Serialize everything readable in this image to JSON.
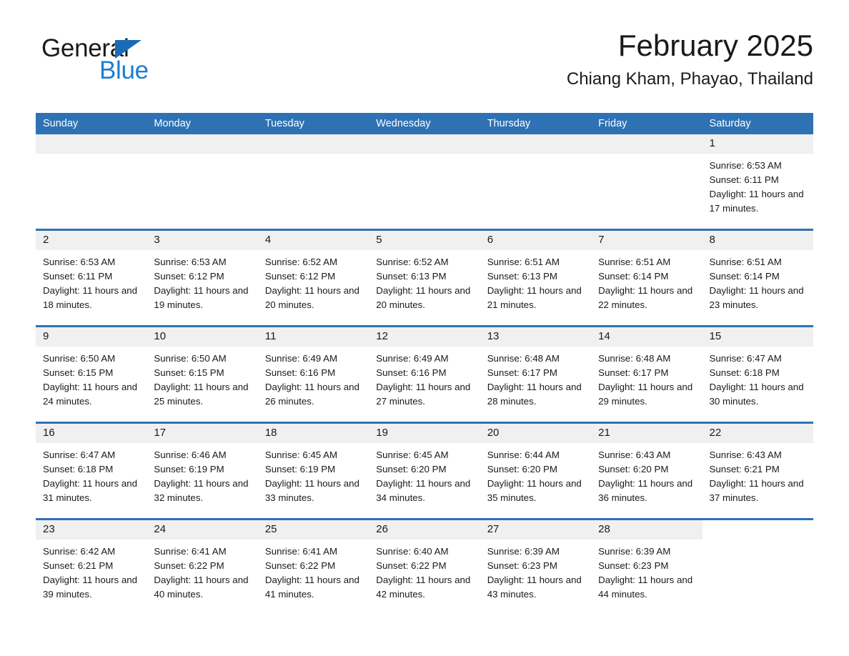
{
  "brand": {
    "name_part1": "General",
    "name_part2": "Blue",
    "accent_color": "#1a7fd4",
    "triangle_color": "#1a6bb5"
  },
  "header": {
    "month_title": "February 2025",
    "location": "Chiang Kham, Phayao, Thailand"
  },
  "calendar": {
    "header_color": "#2e72b4",
    "numband_color": "#f0f0f0",
    "weekdays": [
      "Sunday",
      "Monday",
      "Tuesday",
      "Wednesday",
      "Thursday",
      "Friday",
      "Saturday"
    ],
    "weeks": [
      [
        {
          "day": "",
          "empty": true
        },
        {
          "day": "",
          "empty": true
        },
        {
          "day": "",
          "empty": true
        },
        {
          "day": "",
          "empty": true
        },
        {
          "day": "",
          "empty": true
        },
        {
          "day": "",
          "empty": true
        },
        {
          "day": "1",
          "sunrise": "Sunrise: 6:53 AM",
          "sunset": "Sunset: 6:11 PM",
          "daylight": "Daylight: 11 hours and 17 minutes."
        }
      ],
      [
        {
          "day": "2",
          "sunrise": "Sunrise: 6:53 AM",
          "sunset": "Sunset: 6:11 PM",
          "daylight": "Daylight: 11 hours and 18 minutes."
        },
        {
          "day": "3",
          "sunrise": "Sunrise: 6:53 AM",
          "sunset": "Sunset: 6:12 PM",
          "daylight": "Daylight: 11 hours and 19 minutes."
        },
        {
          "day": "4",
          "sunrise": "Sunrise: 6:52 AM",
          "sunset": "Sunset: 6:12 PM",
          "daylight": "Daylight: 11 hours and 20 minutes."
        },
        {
          "day": "5",
          "sunrise": "Sunrise: 6:52 AM",
          "sunset": "Sunset: 6:13 PM",
          "daylight": "Daylight: 11 hours and 20 minutes."
        },
        {
          "day": "6",
          "sunrise": "Sunrise: 6:51 AM",
          "sunset": "Sunset: 6:13 PM",
          "daylight": "Daylight: 11 hours and 21 minutes."
        },
        {
          "day": "7",
          "sunrise": "Sunrise: 6:51 AM",
          "sunset": "Sunset: 6:14 PM",
          "daylight": "Daylight: 11 hours and 22 minutes."
        },
        {
          "day": "8",
          "sunrise": "Sunrise: 6:51 AM",
          "sunset": "Sunset: 6:14 PM",
          "daylight": "Daylight: 11 hours and 23 minutes."
        }
      ],
      [
        {
          "day": "9",
          "sunrise": "Sunrise: 6:50 AM",
          "sunset": "Sunset: 6:15 PM",
          "daylight": "Daylight: 11 hours and 24 minutes."
        },
        {
          "day": "10",
          "sunrise": "Sunrise: 6:50 AM",
          "sunset": "Sunset: 6:15 PM",
          "daylight": "Daylight: 11 hours and 25 minutes."
        },
        {
          "day": "11",
          "sunrise": "Sunrise: 6:49 AM",
          "sunset": "Sunset: 6:16 PM",
          "daylight": "Daylight: 11 hours and 26 minutes."
        },
        {
          "day": "12",
          "sunrise": "Sunrise: 6:49 AM",
          "sunset": "Sunset: 6:16 PM",
          "daylight": "Daylight: 11 hours and 27 minutes."
        },
        {
          "day": "13",
          "sunrise": "Sunrise: 6:48 AM",
          "sunset": "Sunset: 6:17 PM",
          "daylight": "Daylight: 11 hours and 28 minutes."
        },
        {
          "day": "14",
          "sunrise": "Sunrise: 6:48 AM",
          "sunset": "Sunset: 6:17 PM",
          "daylight": "Daylight: 11 hours and 29 minutes."
        },
        {
          "day": "15",
          "sunrise": "Sunrise: 6:47 AM",
          "sunset": "Sunset: 6:18 PM",
          "daylight": "Daylight: 11 hours and 30 minutes."
        }
      ],
      [
        {
          "day": "16",
          "sunrise": "Sunrise: 6:47 AM",
          "sunset": "Sunset: 6:18 PM",
          "daylight": "Daylight: 11 hours and 31 minutes."
        },
        {
          "day": "17",
          "sunrise": "Sunrise: 6:46 AM",
          "sunset": "Sunset: 6:19 PM",
          "daylight": "Daylight: 11 hours and 32 minutes."
        },
        {
          "day": "18",
          "sunrise": "Sunrise: 6:45 AM",
          "sunset": "Sunset: 6:19 PM",
          "daylight": "Daylight: 11 hours and 33 minutes."
        },
        {
          "day": "19",
          "sunrise": "Sunrise: 6:45 AM",
          "sunset": "Sunset: 6:20 PM",
          "daylight": "Daylight: 11 hours and 34 minutes."
        },
        {
          "day": "20",
          "sunrise": "Sunrise: 6:44 AM",
          "sunset": "Sunset: 6:20 PM",
          "daylight": "Daylight: 11 hours and 35 minutes."
        },
        {
          "day": "21",
          "sunrise": "Sunrise: 6:43 AM",
          "sunset": "Sunset: 6:20 PM",
          "daylight": "Daylight: 11 hours and 36 minutes."
        },
        {
          "day": "22",
          "sunrise": "Sunrise: 6:43 AM",
          "sunset": "Sunset: 6:21 PM",
          "daylight": "Daylight: 11 hours and 37 minutes."
        }
      ],
      [
        {
          "day": "23",
          "sunrise": "Sunrise: 6:42 AM",
          "sunset": "Sunset: 6:21 PM",
          "daylight": "Daylight: 11 hours and 39 minutes."
        },
        {
          "day": "24",
          "sunrise": "Sunrise: 6:41 AM",
          "sunset": "Sunset: 6:22 PM",
          "daylight": "Daylight: 11 hours and 40 minutes."
        },
        {
          "day": "25",
          "sunrise": "Sunrise: 6:41 AM",
          "sunset": "Sunset: 6:22 PM",
          "daylight": "Daylight: 11 hours and 41 minutes."
        },
        {
          "day": "26",
          "sunrise": "Sunrise: 6:40 AM",
          "sunset": "Sunset: 6:22 PM",
          "daylight": "Daylight: 11 hours and 42 minutes."
        },
        {
          "day": "27",
          "sunrise": "Sunrise: 6:39 AM",
          "sunset": "Sunset: 6:23 PM",
          "daylight": "Daylight: 11 hours and 43 minutes."
        },
        {
          "day": "28",
          "sunrise": "Sunrise: 6:39 AM",
          "sunset": "Sunset: 6:23 PM",
          "daylight": "Daylight: 11 hours and 44 minutes."
        },
        {
          "day": "",
          "empty": true,
          "hide_band": true
        }
      ]
    ]
  }
}
